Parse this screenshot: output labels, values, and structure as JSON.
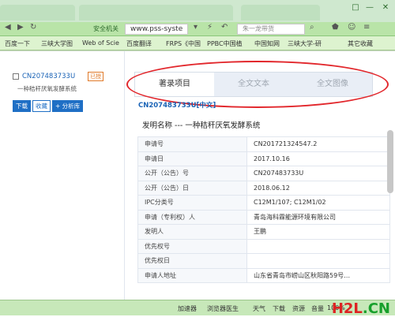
{
  "browser": {
    "window_controls": [
      "□",
      "—",
      "✕"
    ],
    "security_label": "安全机关",
    "url": "www.pss-syste",
    "search_placeholder": "朱一龙带货",
    "nav_icons": [
      "back-icon",
      "forward-icon",
      "refresh-icon"
    ]
  },
  "bookmarks": [
    "百度一下",
    "三峡大学图",
    "Web of Scie",
    "百度翻译",
    "FRPS《中国",
    "PPBC中国植",
    "中国知网",
    "三峡大学-研",
    "其它收藏"
  ],
  "left_panel": {
    "patent_number": "CN207483733U",
    "status_badge": "已授",
    "patent_short_title": "一种秸秆厌氧发酵系统",
    "buttons": [
      "下载",
      "收藏",
      "+ 分析库"
    ]
  },
  "detail": {
    "tabs": [
      "著录项目",
      "全文文本",
      "全文图像"
    ],
    "active_tab_index": 0,
    "header": "CN207483733U[中文]",
    "invention_name_label": "发明名称 ---",
    "invention_name": "一种秸秆厌氧发酵系统",
    "rows": [
      {
        "key": "申请号",
        "value": "CN201721324547.2"
      },
      {
        "key": "申请日",
        "value": "2017.10.16"
      },
      {
        "key": "公开（公告）号",
        "value": "CN207483733U"
      },
      {
        "key": "公开（公告）日",
        "value": "2018.06.12"
      },
      {
        "key": "IPC分类号",
        "value": "C12M1/107; C12M1/02"
      },
      {
        "key": "申请（专利权）人",
        "value": "青岛海科霖能源环境有限公司"
      },
      {
        "key": "发明人",
        "value": "王鹏"
      },
      {
        "key": "优先权号",
        "value": ""
      },
      {
        "key": "优先权日",
        "value": ""
      },
      {
        "key": "申请人地址",
        "value": "山东省青岛市崂山区秋阳路59号…"
      }
    ]
  },
  "statusbar": {
    "items": [
      "加速器",
      "浏览器医生",
      "天气",
      "下载",
      "资源",
      "音量",
      "100%"
    ],
    "watermark": "H2L",
    "watermark_suffix": ".CN"
  },
  "colors": {
    "accent_blue": "#1a63b6",
    "annotation_red": "#e2272c",
    "browser_green": "#b9e4a8"
  }
}
